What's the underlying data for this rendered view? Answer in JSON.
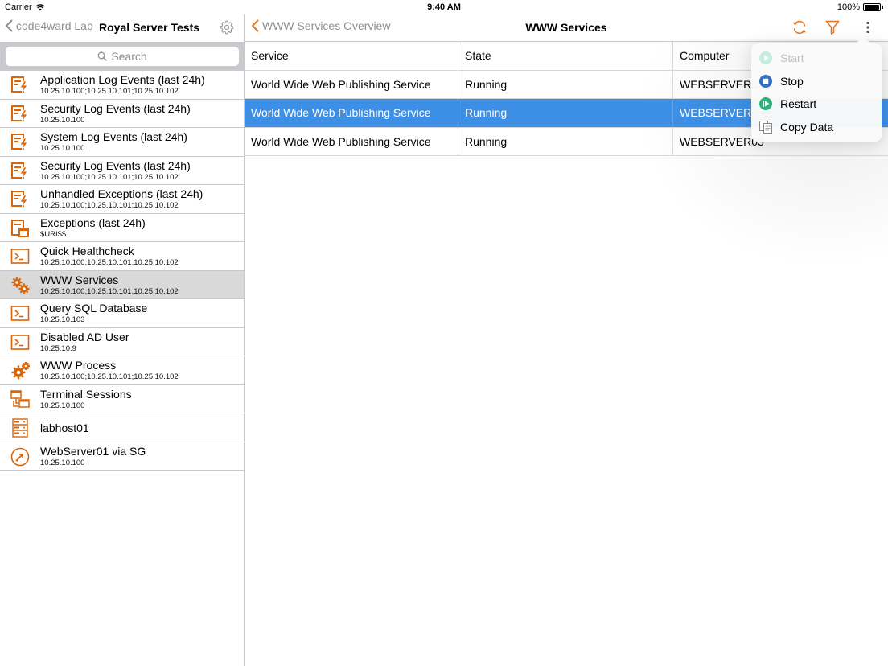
{
  "status_bar": {
    "carrier": "Carrier",
    "time": "9:40 AM",
    "battery": "100%"
  },
  "sidebar": {
    "back_label": "code4ward Lab",
    "title": "Royal Server Tests",
    "search_placeholder": "Search",
    "items": [
      {
        "name": "Application Log Events (last 24h)",
        "sub": "10.25.10.100;10.25.10.101;10.25.10.102",
        "icon": "event-log-icon"
      },
      {
        "name": "Security Log Events (last 24h)",
        "sub": "10.25.10.100",
        "icon": "event-log-icon"
      },
      {
        "name": "System Log Events (last 24h)",
        "sub": "10.25.10.100",
        "icon": "event-log-icon"
      },
      {
        "name": "Security Log Events (last 24h)",
        "sub": "10.25.10.100;10.25.10.101;10.25.10.102",
        "icon": "event-log-icon"
      },
      {
        "name": "Unhandled Exceptions (last 24h)",
        "sub": "10.25.10.100;10.25.10.101;10.25.10.102",
        "icon": "event-log-icon"
      },
      {
        "name": "Exceptions (last 24h)",
        "sub": "$URI$$",
        "icon": "exceptions-icon"
      },
      {
        "name": "Quick Healthcheck",
        "sub": "10.25.10.100;10.25.10.101;10.25.10.102",
        "icon": "powershell-icon"
      },
      {
        "name": "WWW Services",
        "sub": "10.25.10.100;10.25.10.101;10.25.10.102",
        "icon": "services-gear-icon",
        "selected": true
      },
      {
        "name": "Query SQL Database",
        "sub": "10.25.10.103",
        "icon": "powershell-icon"
      },
      {
        "name": "Disabled AD User",
        "sub": "10.25.10.9",
        "icon": "powershell-icon"
      },
      {
        "name": "WWW Process",
        "sub": "10.25.10.100;10.25.10.101;10.25.10.102",
        "icon": "process-gear-icon"
      },
      {
        "name": "Terminal Sessions",
        "sub": "10.25.10.100",
        "icon": "terminal-sessions-icon"
      },
      {
        "name": "labhost01",
        "sub": "",
        "icon": "server-host-icon"
      },
      {
        "name": "WebServer01 via SG",
        "sub": "10.25.10.100",
        "icon": "remote-desktop-icon"
      }
    ]
  },
  "main": {
    "back_label": "WWW Services Overview",
    "title": "WWW Services",
    "columns": [
      "Service",
      "State",
      "Computer"
    ],
    "rows": [
      {
        "service": "World Wide Web Publishing Service",
        "state": "Running",
        "computer": "WEBSERVER01"
      },
      {
        "service": "World Wide Web Publishing Service",
        "state": "Running",
        "computer": "WEBSERVER02",
        "selected": true
      },
      {
        "service": "World Wide Web Publishing Service",
        "state": "Running",
        "computer": "WEBSERVER03"
      }
    ]
  },
  "action_menu": {
    "items": [
      {
        "label": "Start",
        "icon": "start-icon",
        "disabled": true
      },
      {
        "label": "Stop",
        "icon": "stop-icon",
        "disabled": false
      },
      {
        "label": "Restart",
        "icon": "restart-icon",
        "disabled": false
      },
      {
        "label": "Copy Data",
        "icon": "copy-icon",
        "disabled": false
      }
    ]
  },
  "colors": {
    "accent": "#e8731a",
    "selection": "#3d8fe6",
    "tint": "#d9660a",
    "stop_blue": "#2f6fc6",
    "restart_green": "#2fb27a"
  }
}
